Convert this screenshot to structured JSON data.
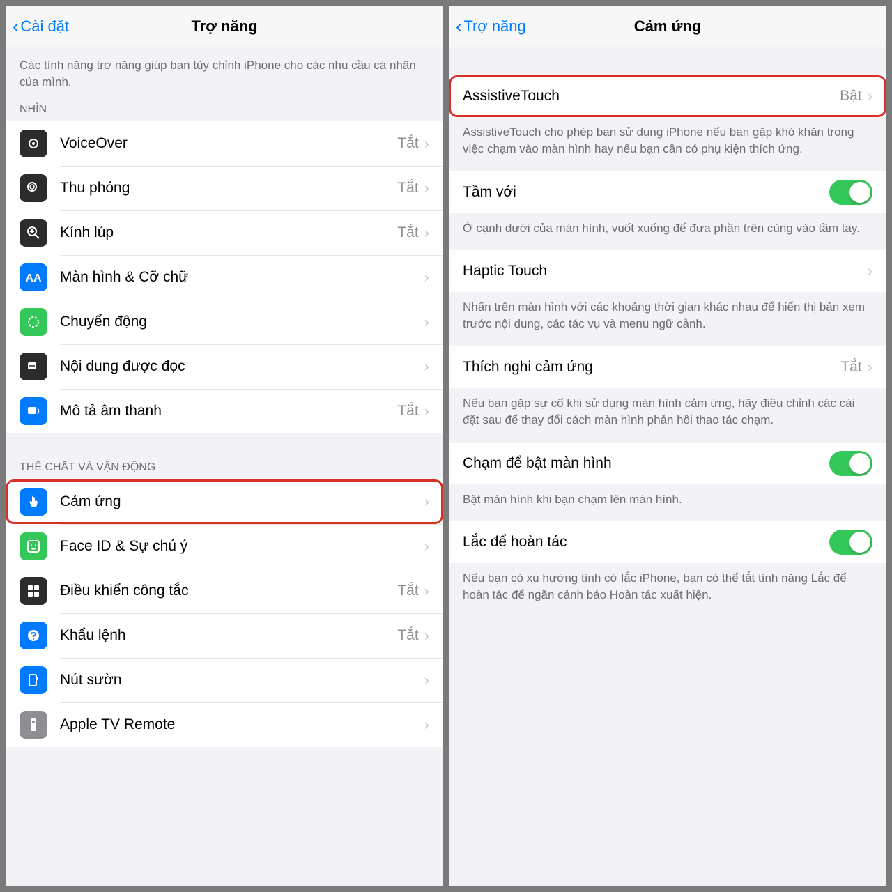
{
  "left": {
    "back": "Cài đặt",
    "title": "Trợ năng",
    "intro": "Các tính năng trợ năng giúp bạn tùy chỉnh iPhone cho các nhu cầu cá nhân của mình.",
    "section_vision": "NHÌN",
    "section_physical": "THỂ CHẤT VÀ VẬN ĐỘNG",
    "vision_rows": [
      {
        "label": "VoiceOver",
        "value": "Tắt",
        "icon": "voiceover"
      },
      {
        "label": "Thu phóng",
        "value": "Tắt",
        "icon": "zoom"
      },
      {
        "label": "Kính lúp",
        "value": "Tắt",
        "icon": "magnifier"
      },
      {
        "label": "Màn hình & Cỡ chữ",
        "value": "",
        "icon": "display"
      },
      {
        "label": "Chuyển động",
        "value": "",
        "icon": "motion"
      },
      {
        "label": "Nội dung được đọc",
        "value": "",
        "icon": "spoken"
      },
      {
        "label": "Mô tả âm thanh",
        "value": "Tắt",
        "icon": "audiodesc"
      }
    ],
    "physical_rows": [
      {
        "label": "Cảm ứng",
        "value": "",
        "icon": "touch",
        "highlight": true
      },
      {
        "label": "Face ID & Sự chú ý",
        "value": "",
        "icon": "faceid"
      },
      {
        "label": "Điều khiển công tắc",
        "value": "Tắt",
        "icon": "switch"
      },
      {
        "label": "Khẩu lệnh",
        "value": "Tắt",
        "icon": "voice"
      },
      {
        "label": "Nút sườn",
        "value": "",
        "icon": "sidebtn"
      },
      {
        "label": "Apple TV Remote",
        "value": "",
        "icon": "appletv"
      }
    ]
  },
  "right": {
    "back": "Trợ năng",
    "title": "Cảm ứng",
    "assistivetouch": {
      "label": "AssistiveTouch",
      "value": "Bật"
    },
    "assistivetouch_note": "AssistiveTouch cho phép bạn sử dụng iPhone nếu bạn gặp khó khăn trong việc chạm vào màn hình hay nếu bạn cần có phụ kiện thích ứng.",
    "reachability": {
      "label": "Tầm với"
    },
    "reachability_note": "Ở cạnh dưới của màn hình, vuốt xuống để đưa phần trên cùng vào tầm tay.",
    "haptic": {
      "label": "Haptic Touch"
    },
    "haptic_note": "Nhấn trên màn hình với các khoảng thời gian khác nhau để hiển thị bản xem trước nội dung, các tác vụ và menu ngữ cảnh.",
    "accommodations": {
      "label": "Thích nghi cảm ứng",
      "value": "Tắt"
    },
    "accommodations_note": "Nếu bạn gặp sự cố khi sử dụng màn hình cảm ứng, hãy điều chỉnh các cài đặt sau để thay đổi cách màn hình phản hồi thao tác chạm.",
    "tapwake": {
      "label": "Chạm để bật màn hình"
    },
    "tapwake_note": "Bật màn hình khi bạn chạm lên màn hình.",
    "shake": {
      "label": "Lắc để hoàn tác"
    },
    "shake_note": "Nếu bạn có xu hướng tình cờ lắc iPhone, bạn có thể tắt tính năng Lắc để hoàn tác để ngăn cảnh báo Hoàn tác xuất hiện."
  }
}
